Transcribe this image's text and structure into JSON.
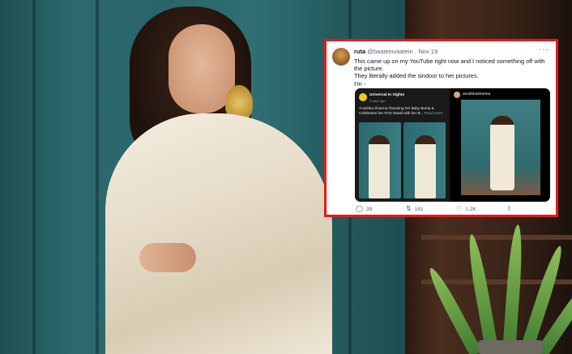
{
  "tweet": {
    "display_name": "ruta",
    "handle": "@baateinvaatein",
    "separator": "·",
    "date": "Nov 19",
    "more_icon": "more-horizontal-icon",
    "text_lines": [
      "This came up on my YouTube right now and I noticed something off with the picture.",
      "They literally added the sindoor to her pictures.",
      "I'm -"
    ],
    "media": {
      "youtube": {
        "channel": "Universal In Sights",
        "time_ago": "3 days ago",
        "title": "Anushka Sharma Flaunting her Baby Bump & Celebrates her First Diwali with her B...",
        "read_more": "Read more"
      },
      "instagram": {
        "username": "anushkasharma"
      }
    },
    "actions": {
      "replies": "39",
      "retweets": "161",
      "likes": "1.2K",
      "reply_icon": "reply-icon",
      "retweet_icon": "retweet-icon",
      "like_icon": "heart-icon",
      "share_icon": "share-icon"
    }
  },
  "colors": {
    "highlight_border": "#e21b1b",
    "tweet_text": "#0f1419",
    "tweet_meta": "#536471"
  }
}
